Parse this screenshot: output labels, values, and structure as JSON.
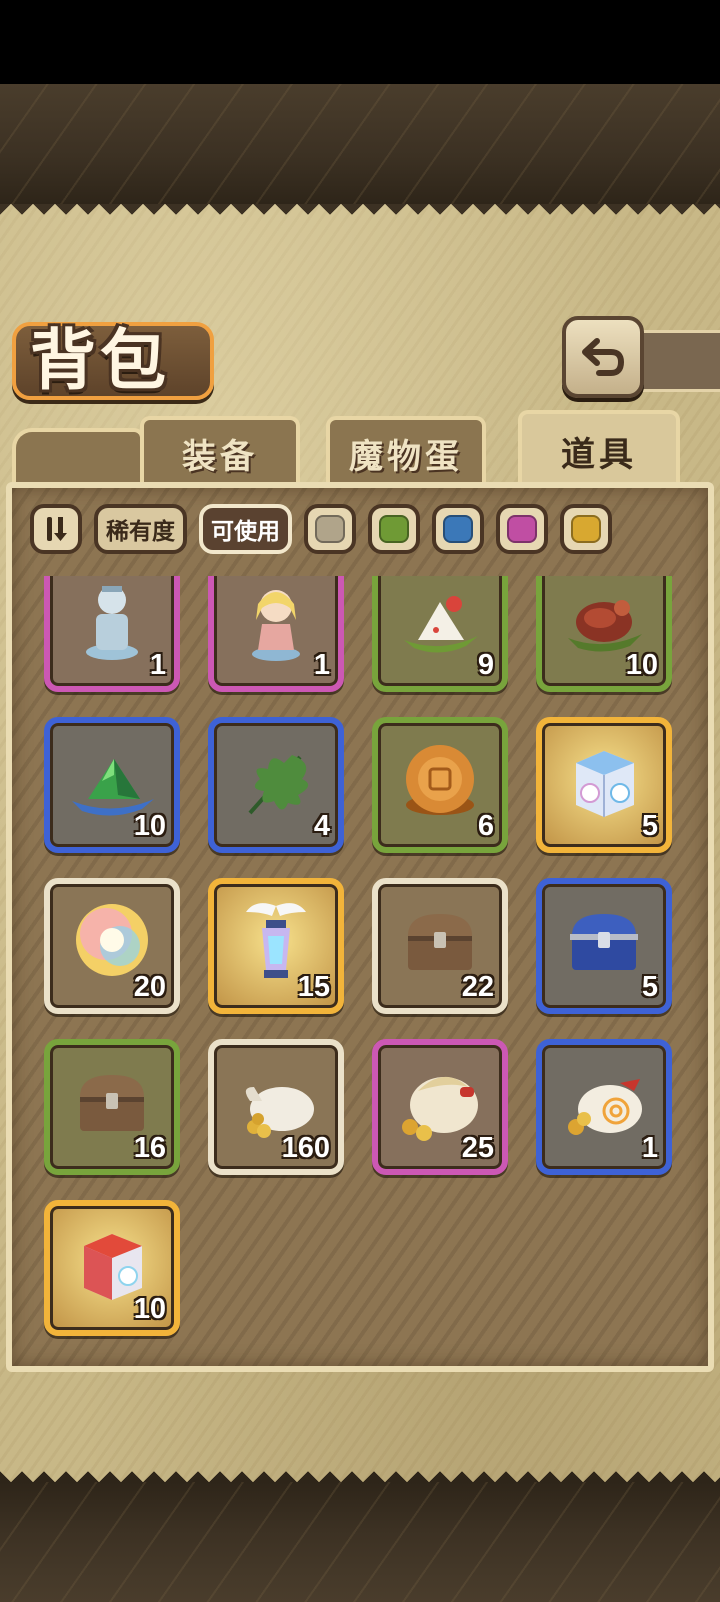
{
  "header": {
    "title": "背包"
  },
  "tabs": [
    {
      "label": "装备",
      "active": false
    },
    {
      "label": "魔物蛋",
      "active": false
    },
    {
      "label": "道具",
      "active": true
    }
  ],
  "filters": {
    "rarity_label": "稀有度",
    "usable_label": "可使用",
    "rarity_colors": [
      "#b0a48a",
      "#6f9a35",
      "#3b78b8",
      "#c04ea3",
      "#d8a830"
    ]
  },
  "items": [
    {
      "name": "figurine-gray",
      "rarity": "purple",
      "icon": "figurine-icon",
      "qty": "1"
    },
    {
      "name": "figurine-girl",
      "rarity": "purple",
      "icon": "figurine-girl-icon",
      "qty": "1"
    },
    {
      "name": "rice-dumpling",
      "rarity": "green",
      "icon": "rice-ball-icon",
      "qty": "9"
    },
    {
      "name": "roasted-meat",
      "rarity": "green",
      "icon": "meat-icon",
      "qty": "10"
    },
    {
      "name": "green-zongzi",
      "rarity": "blue",
      "icon": "green-pyramid-icon",
      "qty": "10"
    },
    {
      "name": "herb-leaf",
      "rarity": "blue",
      "icon": "leaf-icon",
      "qty": "4"
    },
    {
      "name": "mooncake",
      "rarity": "green",
      "icon": "mooncake-icon",
      "qty": "6"
    },
    {
      "name": "blue-mystery-box",
      "rarity": "gold",
      "icon": "blue-box-icon",
      "qty": "5"
    },
    {
      "name": "rainbow-orb",
      "rarity": "white",
      "icon": "rainbow-orb-icon",
      "qty": "20"
    },
    {
      "name": "winged-lantern",
      "rarity": "gold",
      "icon": "lantern-icon",
      "qty": "15"
    },
    {
      "name": "wooden-chest-gray",
      "rarity": "white",
      "icon": "chest-icon",
      "qty": "22"
    },
    {
      "name": "blue-chest",
      "rarity": "blue",
      "icon": "blue-chest-icon",
      "qty": "5"
    },
    {
      "name": "wooden-chest-green",
      "rarity": "green",
      "icon": "chest-icon",
      "qty": "16"
    },
    {
      "name": "coin-sack-small",
      "rarity": "white",
      "icon": "coin-sack-icon",
      "qty": "160"
    },
    {
      "name": "coin-sack-large",
      "rarity": "purple",
      "icon": "coin-sack-big-icon",
      "qty": "25"
    },
    {
      "name": "coin-sack-spiral",
      "rarity": "blue",
      "icon": "coin-sack-spiral-icon",
      "qty": "1"
    },
    {
      "name": "red-mystery-box",
      "rarity": "gold",
      "icon": "red-box-icon",
      "qty": "10"
    }
  ]
}
